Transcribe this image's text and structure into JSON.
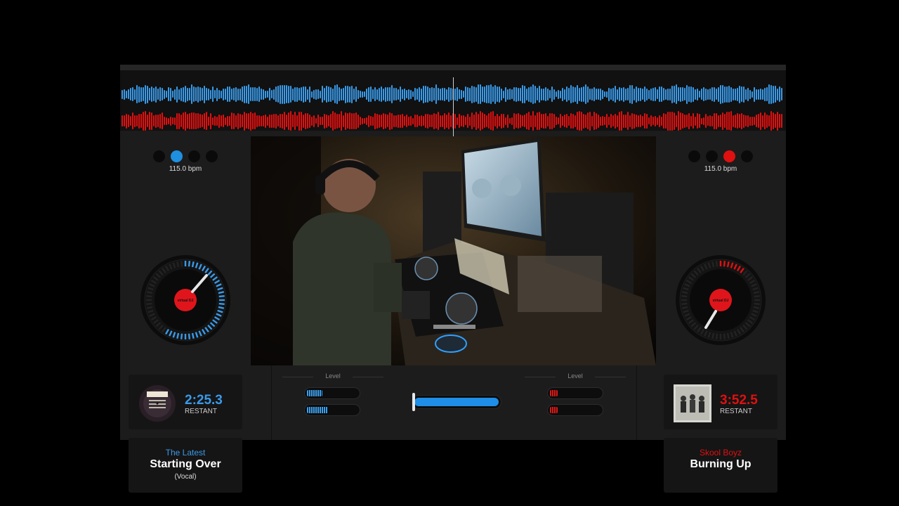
{
  "deck_a": {
    "bpm": "115.0 bpm",
    "active_dot": 1,
    "time": "2:25.3",
    "time_label": "RESTANT",
    "artist": "The Latest",
    "title": "Starting Over",
    "mix": "(Vocal)",
    "level_meters": [
      0.3,
      0.4
    ],
    "accent": "#3a9ae8",
    "art_icon": "vinyl-record-art-icon"
  },
  "deck_b": {
    "bpm": "115.0 bpm",
    "active_dot": 2,
    "time": "3:52.5",
    "time_label": "RESTANT",
    "artist": "Skool Boyz",
    "title": "Burning Up",
    "mix": "",
    "level_meters": [
      0.15,
      0.15
    ],
    "accent": "#e01010",
    "art_icon": "album-cover-group-photo-icon"
  },
  "mixer": {
    "level_label_left": "Level",
    "level_label_right": "Level",
    "crossfader_position": 0.0
  },
  "platter_logo_text": "virtual DJ",
  "video": {
    "subject": "dj-webcam-feed"
  }
}
